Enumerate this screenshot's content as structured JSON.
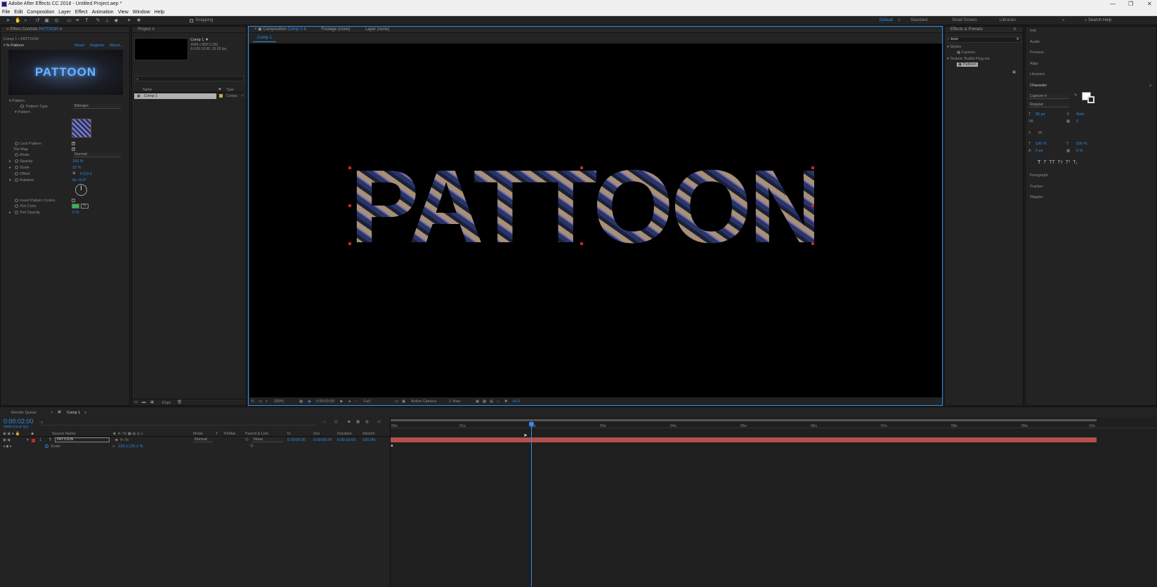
{
  "app": {
    "title": "Adobe After Effects CC 2018 - Untitled Project.aep *",
    "menus": [
      "File",
      "Edit",
      "Composition",
      "Layer",
      "Effect",
      "Animation",
      "View",
      "Window",
      "Help"
    ]
  },
  "toolbar": {
    "snapping": "Snapping",
    "workspaces": [
      "Default",
      "Standard",
      "Small Screen",
      "Libraries"
    ],
    "active_workspace": "Default",
    "search_help": "Search Help"
  },
  "effect_controls": {
    "tab": "Effect Controls",
    "tab_target": "PATTOON",
    "breadcrumb": "Comp 1 • PATTOON",
    "effect_name": "Pattoon",
    "links": [
      "Reset",
      "Register",
      "About..."
    ],
    "logo_text": "PATTOON",
    "group": "Pattern",
    "pattern_type_label": "Pattern Type",
    "pattern_type_value": "Bitmaps",
    "pattern_sub": "Pattern",
    "lock_pattern": "Lock Pattern",
    "tile_map": "Tile Map",
    "mode_label": "Mode",
    "mode_value": "Normal",
    "opacity_label": "Opacity",
    "opacity_value": "100 %",
    "scale_label": "Scale",
    "scale_value": "22 %",
    "offset_label": "Offset",
    "offset_value": "0.0,0.0",
    "rotation_label": "Rotation",
    "rotation_value": "0x +0.0°",
    "invert_label": "Invert Pattern Colors",
    "tint_color_label": "Tint Color",
    "tint_opacity_label": "Tint Opacity",
    "tint_opacity_value": "0 %",
    "tint_color": "#3bb34a"
  },
  "project": {
    "tab": "Project",
    "comp_name": "Comp 1 ▼",
    "comp_info1": "2048 x 858 (1.00)",
    "comp_info2": "Δ 0:00:10:00, 25.00 fps",
    "col_name": "Name",
    "col_type": "Type",
    "item_name": "Comp 1",
    "item_type": "Compo",
    "bpc": "8 bpc"
  },
  "composition": {
    "tab": "Composition",
    "tab_target": "Comp 1",
    "footage": "Footage (none)",
    "layer": "Layer (none)",
    "subtab": "Comp 1",
    "text": "PATTOON",
    "zoom": "200%",
    "timecode": "0:00:02:00",
    "quality": "Full",
    "camera": "Active Camera",
    "views": "1 View",
    "exposure": "+0.0"
  },
  "effects_presets": {
    "tab": "Effects & Presets",
    "search": "toon",
    "items": [
      "Stylize",
      "Cartoon",
      "Texture Toolkit Plug-ins",
      "Pattoon"
    ]
  },
  "right_panels": {
    "items": [
      "Info",
      "Audio",
      "Preview",
      "Align",
      "Libraries"
    ],
    "character": "Character",
    "font": "Capture it",
    "style": "Regular",
    "size": "36 px",
    "leading": "Auto",
    "tracking": "0",
    "unit": "px",
    "vscale": "100 %",
    "hscale": "100 %",
    "baseline": "0 px",
    "tsume": "0 %",
    "bottom_items": [
      "Paragraph",
      "Tracker",
      "Wiggler"
    ]
  },
  "timeline": {
    "tabs": [
      "Render Queue",
      "Comp 1"
    ],
    "timecode": "0:00:02:00",
    "timecode_sub": "00050 (25.00 fps)",
    "columns": [
      "Source Name",
      "Mode",
      "T",
      "TrkMat",
      "Parent & Link",
      "In",
      "Out",
      "Duration",
      "Stretch"
    ],
    "layer_num": "1",
    "layer_name": "PATTOON",
    "layer_mode": "Normal",
    "layer_parent": "None",
    "layer_in": "0:00:00:00",
    "layer_out": "0:00:09:24",
    "layer_dur": "0:00:10:00",
    "layer_stretch": "100.0%",
    "sub_prop": "Scale",
    "sub_value": "120.1,120.1 %",
    "ruler": [
      "00s",
      "01s",
      "02s",
      "03s",
      "04s",
      "05s",
      "06s",
      "07s",
      "08s",
      "09s",
      "10s"
    ]
  }
}
